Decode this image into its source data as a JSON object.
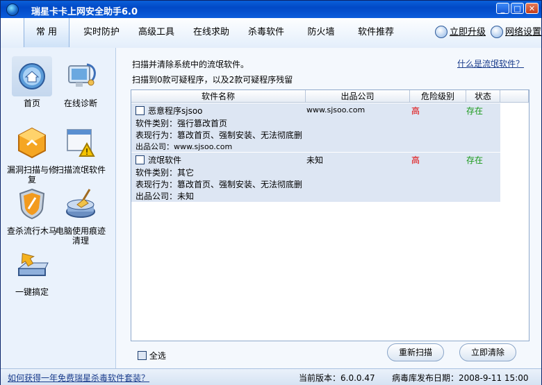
{
  "window": {
    "title": "瑞星卡卡上网安全助手6.0"
  },
  "menu": {
    "items": [
      "常 用",
      "实时防护",
      "高级工具",
      "在线求助",
      "杀毒软件",
      "防火墙",
      "软件推荐"
    ],
    "upgrade": "立即升级",
    "network_settings": "网络设置"
  },
  "sidebar": {
    "items": [
      {
        "label": "首页",
        "icon": "home-icon"
      },
      {
        "label": "在线诊断",
        "icon": "diagnosis-icon"
      },
      {
        "label": "漏洞扫描与修复",
        "icon": "vulnerability-icon"
      },
      {
        "label": "扫描流氓软件",
        "icon": "rogue-scan-icon"
      },
      {
        "label": "查杀流行木马",
        "icon": "trojan-shield-icon"
      },
      {
        "label": "电脑使用痕迹清理",
        "icon": "broom-icon"
      },
      {
        "label": "一键搞定",
        "icon": "one-click-icon"
      }
    ]
  },
  "content": {
    "desc1": "扫描并清除系统中的流氓软件。",
    "desc2": "扫描到0款可疑程序，以及2款可疑程序残留",
    "help_link": "什么是流氓软件？",
    "table": {
      "headers": [
        "软件名称",
        "出品公司",
        "危险级别",
        "状态"
      ],
      "rows": [
        {
          "name": "恶意程序sjsoo",
          "company": "www.sjsoo.com",
          "danger": "高",
          "status": "存在",
          "detail_type": "软件类别：强行篡改首页",
          "detail_behavior": "表现行为：篡改首页、强制安装、无法彻底删",
          "detail_company": "出品公司：www.sjsoo.com"
        },
        {
          "name": "流氓软件",
          "company": "未知",
          "danger": "高",
          "status": "存在",
          "detail_type": "软件类别：其它",
          "detail_behavior": "表现行为：篡改首页、强制安装、无法彻底删",
          "detail_company": "出品公司：未知"
        }
      ]
    },
    "select_all": "全选",
    "rescan": "重新扫描",
    "clean_now": "立即清除"
  },
  "status": {
    "promo_link": "如何获得一年免费瑞星杀毒软件套装？",
    "version": "当前版本：6.0.0.47",
    "virus_db": "病毒库发布日期：2008-9-11 15:00"
  },
  "colors": {
    "danger": "#e00000",
    "exists": "#1a9a1a",
    "title_bar": "#0149c6"
  }
}
